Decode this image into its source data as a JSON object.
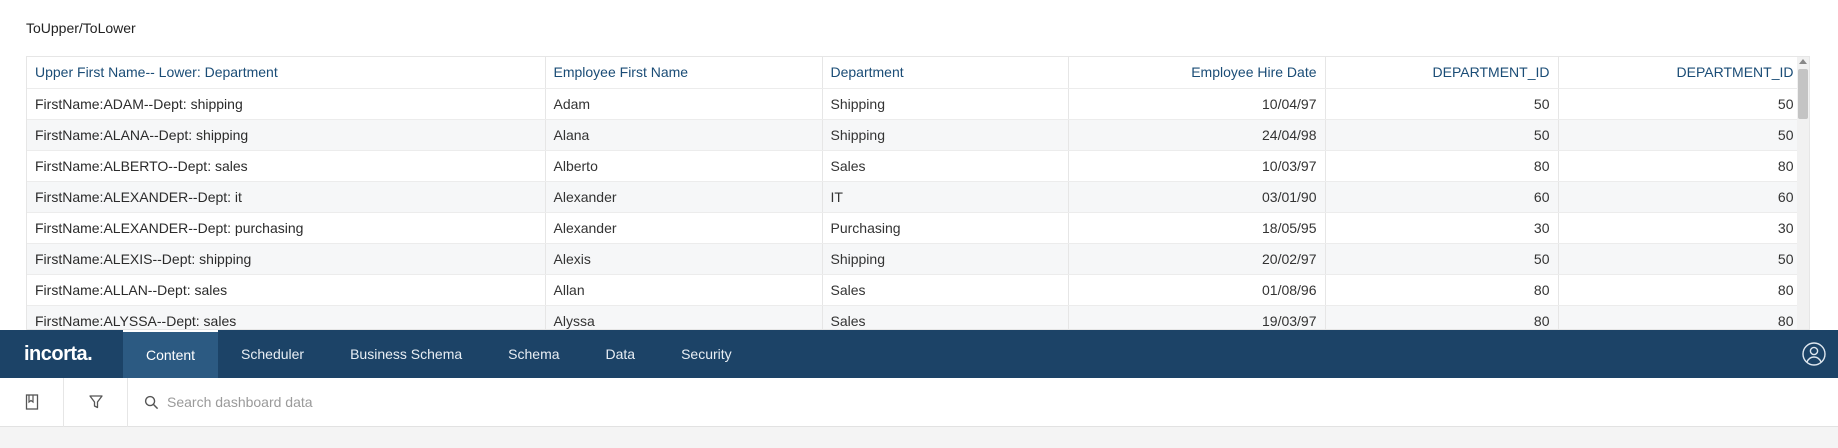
{
  "widget": {
    "title": "ToUpper/ToLower"
  },
  "table": {
    "columns": [
      "Upper First Name-- Lower: Department",
      "Employee First Name",
      "Department",
      "Employee Hire Date",
      "DEPARTMENT_ID",
      "DEPARTMENT_ID"
    ],
    "rows": [
      [
        "FirstName:ADAM--Dept: shipping",
        "Adam",
        "Shipping",
        "10/04/97",
        "50",
        "50"
      ],
      [
        "FirstName:ALANA--Dept: shipping",
        "Alana",
        "Shipping",
        "24/04/98",
        "50",
        "50"
      ],
      [
        "FirstName:ALBERTO--Dept: sales",
        "Alberto",
        "Sales",
        "10/03/97",
        "80",
        "80"
      ],
      [
        "FirstName:ALEXANDER--Dept: it",
        "Alexander",
        "IT",
        "03/01/90",
        "60",
        "60"
      ],
      [
        "FirstName:ALEXANDER--Dept: purchasing",
        "Alexander",
        "Purchasing",
        "18/05/95",
        "30",
        "30"
      ],
      [
        "FirstName:ALEXIS--Dept: shipping",
        "Alexis",
        "Shipping",
        "20/02/97",
        "50",
        "50"
      ],
      [
        "FirstName:ALLAN--Dept: sales",
        "Allan",
        "Sales",
        "01/08/96",
        "80",
        "80"
      ],
      [
        "FirstName:ALYSSA--Dept: sales",
        "Alyssa",
        "Sales",
        "19/03/97",
        "80",
        "80"
      ]
    ]
  },
  "nav": {
    "logo": "incorta.",
    "items": [
      "Content",
      "Scheduler",
      "Business Schema",
      "Schema",
      "Data",
      "Security"
    ],
    "active": "Content"
  },
  "toolbar": {
    "bookmark_icon": "bookmark-icon",
    "filter_icon": "filter-icon",
    "search_icon": "search-icon",
    "search_placeholder": "Search dashboard data"
  },
  "colors": {
    "navbar": "#1c4367",
    "nav_active": "#2c5a82",
    "header_text": "#1a4c76"
  }
}
